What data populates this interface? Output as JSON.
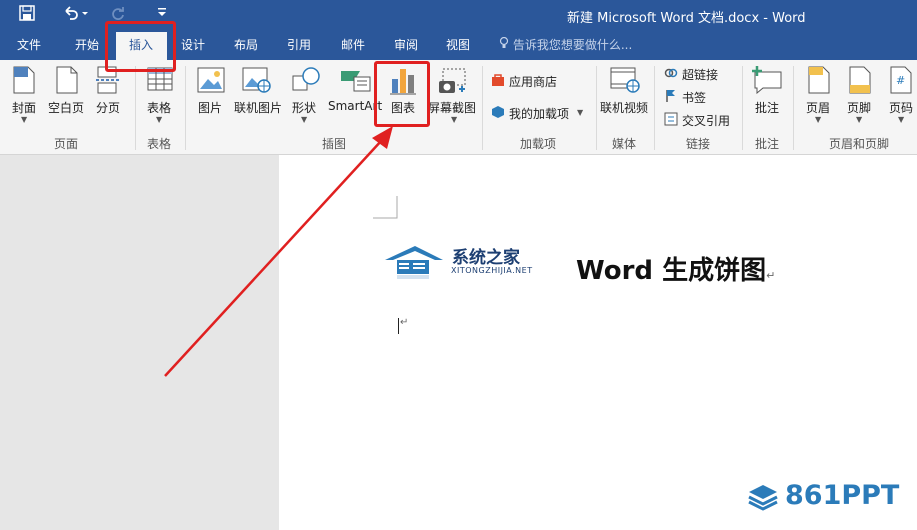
{
  "window": {
    "title": "新建 Microsoft Word 文档.docx - Word"
  },
  "quick_access": {
    "save_icon": "save-icon",
    "undo_icon": "undo-icon",
    "redo_icon": "redo-icon",
    "customize_icon": "customize-qat-icon"
  },
  "tabs": [
    "文件",
    "开始",
    "插入",
    "设计",
    "布局",
    "引用",
    "邮件",
    "审阅",
    "视图"
  ],
  "tell_me": {
    "placeholder": "告诉我您想要做什么..."
  },
  "ribbon": {
    "pages_group": {
      "label": "页面",
      "buttons": [
        "封面",
        "空白页",
        "分页"
      ]
    },
    "tables_group": {
      "label": "表格",
      "buttons": [
        "表格"
      ]
    },
    "illustrations_group": {
      "label": "插图",
      "buttons": [
        "图片",
        "联机图片",
        "形状",
        "SmartArt",
        "图表",
        "屏幕截图"
      ]
    },
    "addins_group": {
      "label": "加载项",
      "buttons": [
        "应用商店",
        "我的加载项"
      ]
    },
    "media_group": {
      "label": "媒体",
      "buttons": [
        "联机视频"
      ]
    },
    "links_group": {
      "label": "链接",
      "buttons": [
        "超链接",
        "书签",
        "交叉引用"
      ]
    },
    "comments_group": {
      "label": "批注",
      "buttons": [
        "批注"
      ]
    },
    "header_footer_group": {
      "label": "页眉和页脚",
      "buttons": [
        "页眉",
        "页脚",
        "页码"
      ]
    }
  },
  "document": {
    "logo_text": "系统之家",
    "logo_sub": "XITONGZHIJIA.NET",
    "heading": "Word 生成饼图",
    "para_mark": "↵"
  },
  "watermark": {
    "text": "861PPT"
  },
  "colors": {
    "title_bar": "#2b579a",
    "highlight": "#e02020",
    "ribbon_bg": "#f5f5f5"
  }
}
